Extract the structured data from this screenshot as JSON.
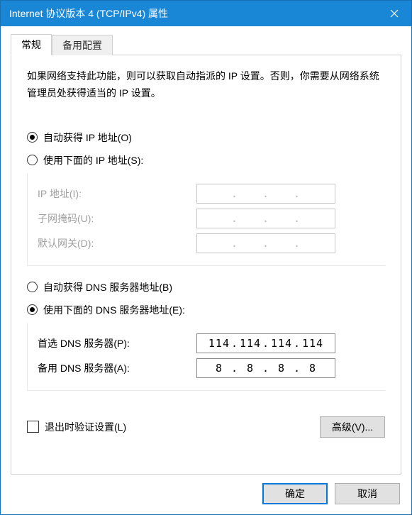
{
  "window": {
    "title": "Internet 协议版本 4 (TCP/IPv4) 属性"
  },
  "tabs": {
    "general": "常规",
    "alternate": "备用配置"
  },
  "description": "如果网络支持此功能，则可以获取自动指派的 IP 设置。否则，你需要从网络系统管理员处获得适当的 IP 设置。",
  "ip_section": {
    "auto_label": "自动获得 IP 地址(O)",
    "manual_label": "使用下面的 IP 地址(S):",
    "selected": "auto",
    "fields": {
      "ip_label": "IP 地址(I):",
      "subnet_label": "子网掩码(U):",
      "gateway_label": "默认网关(D):",
      "ip_value": [
        "",
        "",
        "",
        ""
      ],
      "subnet_value": [
        "",
        "",
        "",
        ""
      ],
      "gateway_value": [
        "",
        "",
        "",
        ""
      ]
    }
  },
  "dns_section": {
    "auto_label": "自动获得 DNS 服务器地址(B)",
    "manual_label": "使用下面的 DNS 服务器地址(E):",
    "selected": "manual",
    "fields": {
      "preferred_label": "首选 DNS 服务器(P):",
      "alternate_label": "备用 DNS 服务器(A):",
      "preferred_value": [
        "114",
        "114",
        "114",
        "114"
      ],
      "alternate_value": [
        "8",
        "8",
        "8",
        "8"
      ]
    }
  },
  "validate_checkbox": {
    "label": "退出时验证设置(L)",
    "checked": false
  },
  "buttons": {
    "advanced": "高级(V)...",
    "ok": "确定",
    "cancel": "取消"
  }
}
